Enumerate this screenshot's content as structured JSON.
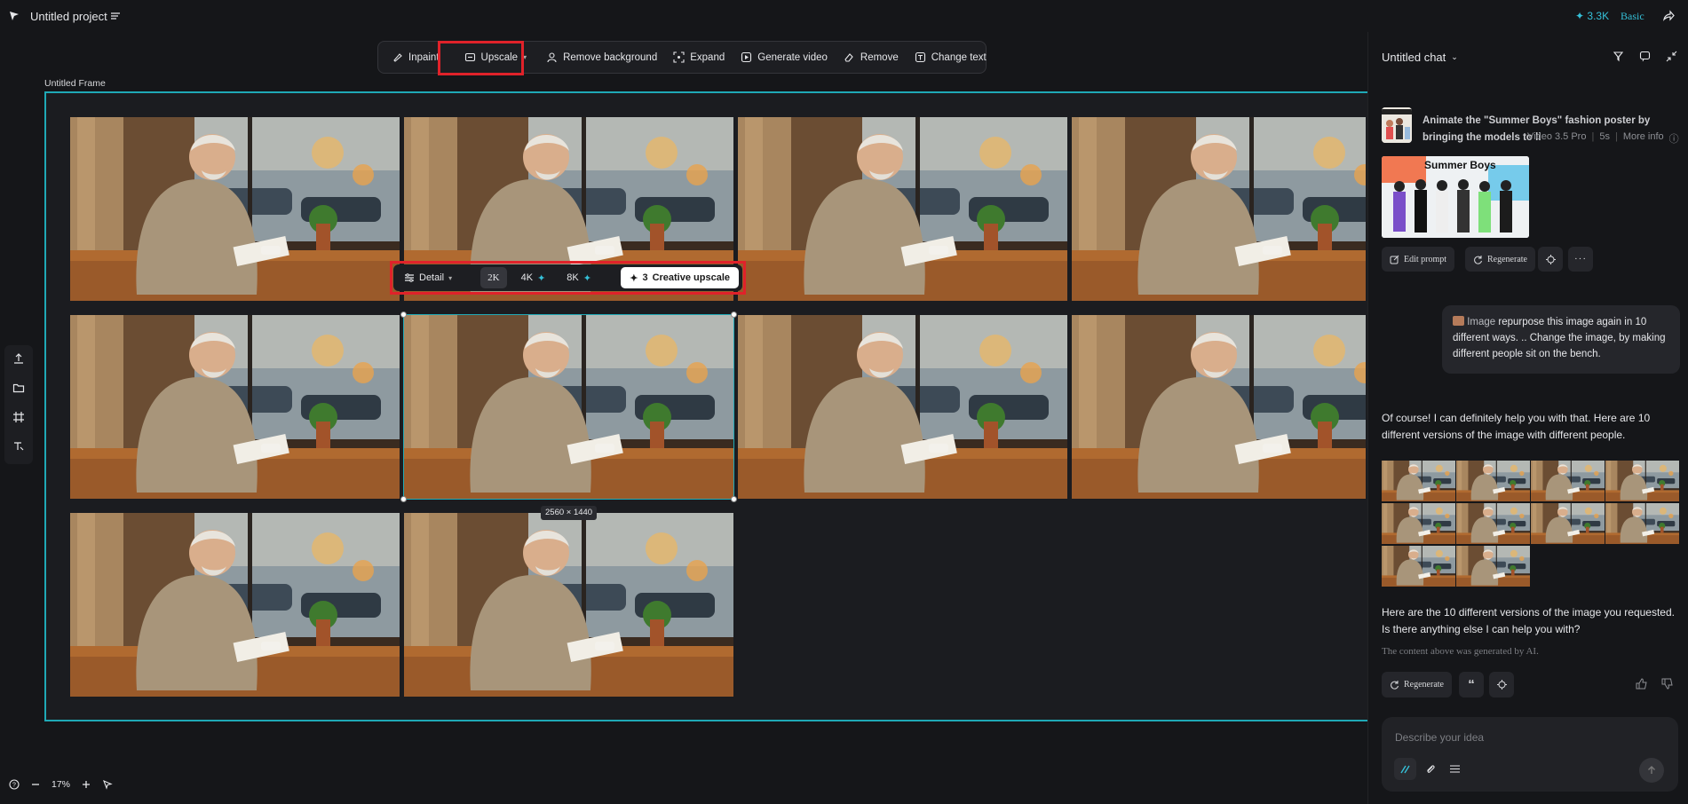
{
  "header": {
    "project_title": "Untitled project",
    "credits": "3.3K",
    "plan": "Basic"
  },
  "toolbar": {
    "inpaint": "Inpaint",
    "upscale": "Upscale",
    "remove_background": "Remove background",
    "expand": "Expand",
    "generate_video": "Generate video",
    "remove": "Remove",
    "change_text": "Change text"
  },
  "canvas": {
    "frame_label": "Untitled Frame",
    "selected_dimensions": "2560 × 1440",
    "zoom": "17%"
  },
  "upscale_bar": {
    "detail": "Detail",
    "opt_2k": "2K",
    "opt_4k": "4K",
    "opt_8k": "8K",
    "creative_cost": "3",
    "creative_label": "Creative upscale"
  },
  "chat": {
    "title": "Untitled chat",
    "prompt_text": "Animate the \"Summer Boys\" fashion poster by bringing the models to li",
    "model": "Video 3.5 Pro",
    "duration": "5s",
    "more_info": "More info",
    "poster_title": "Summer Boys",
    "edit_prompt": "Edit prompt",
    "regenerate": "Regenerate",
    "user_tag": "Image",
    "user_message": "repurpose this image again in 10 different ways. .. Change the image, by making different people sit on the bench.",
    "ai_reply_1": "Of course! I can definitely help you with that. Here are 10 different versions of the image with different people.",
    "ai_reply_2": "Here are the 10 different versions of the image you requested. Is there anything else I can help you with?",
    "disclaimer": "The content above was generated by AI.",
    "regenerate_2": "Regenerate",
    "input_placeholder": "Describe your idea"
  },
  "colors": {
    "accent": "#1fa9b6",
    "credits": "#35c0d8",
    "highlight": "#e0222a"
  }
}
